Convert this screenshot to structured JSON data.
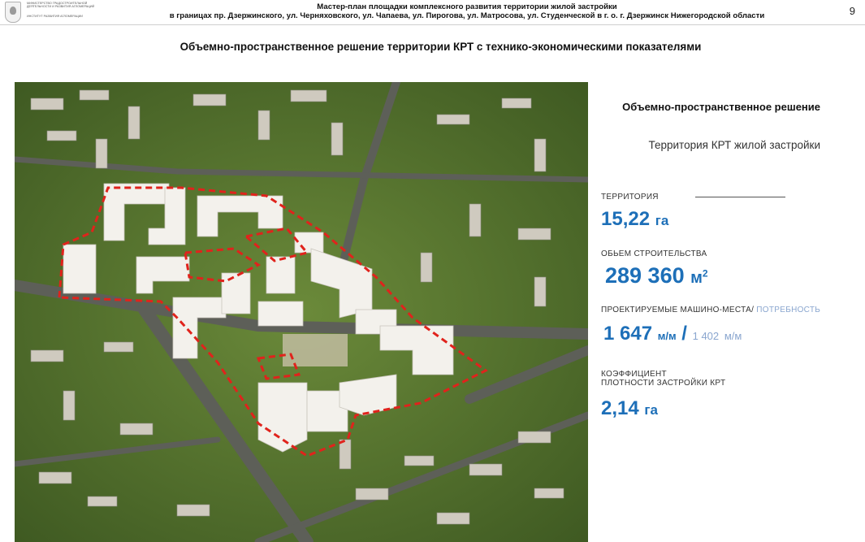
{
  "header": {
    "ministry": "Министерство градостроительной деятельности и развития агломераций",
    "institute": "Институт развития агломерации",
    "title_line1": "Мастер-план площадки комплексного развития территории жилой застройки",
    "title_line2": "в границах пр. Дзержинского, ул. Черняховского, ул. Чапаева, ул. Пирогова, ул. Матросова, ул. Студенческой в г. о. г. Дзержинск Нижегородской области",
    "page_number": "9"
  },
  "subtitle": "Объемно-пространственное решение территории КРТ  с технико-экономическими показателями",
  "panel": {
    "title": "Объемно-пространственное решение",
    "subtitle": "Территория КРТ жилой застройки",
    "territory": {
      "label": "ТЕРРИТОРИЯ",
      "value": "15,22",
      "unit": "га"
    },
    "construction": {
      "label": "ОБЬЕМ СТРОИТЕЛЬСТВА",
      "value": "289 360",
      "unit": "м",
      "unit_sup": "2"
    },
    "parking": {
      "label": "ПРОЕКТИРУЕМЫЕ  МАШИНО-МЕСТА/",
      "label_need": " ПОТРЕБНОСТЬ",
      "value": "1 647",
      "unit": "м/м",
      "slash": " / ",
      "need_value": "1 402",
      "need_unit": "м/м"
    },
    "density": {
      "label_line1": "КОЭФФИЦИЕНТ",
      "label_line2": "ПЛОТНОСТИ ЗАСТРОЙКИ КРТ",
      "value": "2,14",
      "unit": "га"
    }
  },
  "colors": {
    "accent": "#1d6fb8",
    "muted_accent": "#8aa6cf",
    "boundary": "#e0231c"
  }
}
